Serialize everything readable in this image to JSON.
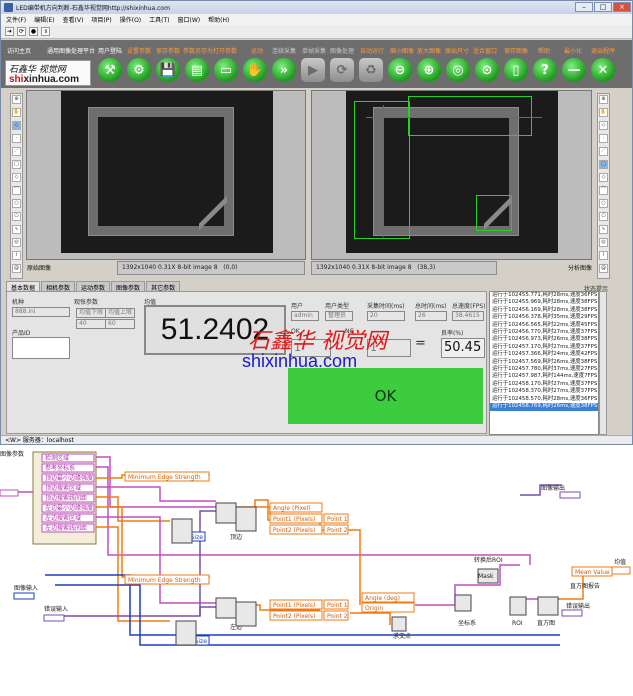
{
  "window": {
    "title": "LED编带机方向判断-石鑫华视觉网http://shixinhua.com"
  },
  "menu": [
    "文件(F)",
    "编辑(E)",
    "查看(V)",
    "项目(P)",
    "操作(O)",
    "工具(T)",
    "窗口(W)",
    "帮助(H)"
  ],
  "logo": {
    "line1": "石鑫华 视觉网",
    "line2_red": "shi",
    "line2_rest": "xinhua.com"
  },
  "nav": [
    "访问主页",
    "通用图像处理平台",
    "用户登陆",
    "设置参数",
    "保存参数",
    "参数另存为",
    "打开参数",
    "运动",
    "连续采集",
    "单帧采集",
    "图像处理",
    "自动运行",
    "缩小图像",
    "放大图像",
    "原始尺寸",
    "适合窗口",
    "保存图像",
    "帮助",
    "最小化",
    "退出程序"
  ],
  "toolbar_icons": [
    "home-icon",
    "user-icon",
    "tools-icon",
    "save-icon",
    "save-as-icon",
    "open-icon",
    "hand-icon",
    "fast-forward-icon",
    "play-icon",
    "process-icon",
    "recycle-icon",
    "zoom-out-icon",
    "zoom-in-icon",
    "zoom-actual-icon",
    "zoom-fit-icon",
    "save-image-icon",
    "help-icon",
    "minimize-icon",
    "close-icon"
  ],
  "left_image": {
    "label": "原始图像",
    "status": "1392x1040 0.31X 8-bit image 8",
    "coords": "(0,0)"
  },
  "right_image": {
    "label": "分析图像",
    "status": "1392x1040 0.31X 8-bit image 8",
    "coords": "(38,3)"
  },
  "tabs": [
    "基本数据",
    "相机参数",
    "运动参数",
    "图像参数",
    "其它参数"
  ],
  "params": {
    "model_label": "机种",
    "model_value": "888.ini",
    "product_label": "产品ID",
    "view_label": "观怅参数",
    "lower_label": "均值下限",
    "lower_value": "40",
    "upper_label": "均值上限",
    "upper_value": "60",
    "mean_label": "均值",
    "mean_value": "51.2402",
    "user_label": "用户",
    "user_value": "admin",
    "usertype_label": "用户类型",
    "usertype_value": "管理员",
    "acq_label": "采集时间(ms)",
    "acq_value": "20",
    "total_label": "总时间(ms)",
    "total_value": "26",
    "fps_label": "总速度(FPS)",
    "fps_value": "38.4615",
    "ok_label": "OK",
    "ng_label": "NG",
    "ok_count": "1",
    "ng_count": "1",
    "rate_label": "良率(%)",
    "rate_value": "50.45"
  },
  "status_label": "状态提示",
  "log": [
    "运行于102455.771,耗时28ms,速度36FPS",
    "运行于102455.969,耗时28ms,速度38FPS",
    "运行于102456.169,耗时28ms,速度38FPS",
    "运行于102456.378,耗时35ms,速度29FPS",
    "运行于102456.565,耗时22ms,速度45FPS",
    "运行于102456.770,耗时27ms,速度37FPS",
    "运行于102456.973,耗时26ms,速度38FPS",
    "运行于102457.170,耗时27ms,速度37FPS",
    "运行于102457.366,耗时24ms,速度42FPS",
    "运行于102457.569,耗时26ms,速度38FPS",
    "运行于102457.780,耗时37ms,速度27FPS",
    "运行于102457.987,耗时144ms,速度7FPS",
    "运行于102458.170,耗时27ms,速度37FPS",
    "运行于102458.370,耗时27ms,速度37FPS",
    "运行于102458.570,耗时28ms,速度36FPS",
    "运行于102458.769,耗时26ms,速度38FPS"
  ],
  "watermark": {
    "top": "石鑫华 视觉网",
    "bottom": "shixinhua.com"
  },
  "server": "<W> 服务器：localhost",
  "diagram": {
    "image_params": "图像参数",
    "image_input": "图像输入",
    "error_input": "错误输入",
    "cluster_items": [
      "检测区域",
      "参考坐标系",
      "顶边最小边缘强度",
      "顶边搜索区域",
      "顶边搜索线间距",
      "左边最小边缘强度",
      "左边搜索区域",
      "左边搜索线间距"
    ],
    "min_edge": "Minimum Edge Strength",
    "step_size": "Step Size",
    "angle_pixel": "Angle (Pixel)",
    "point1_pixels": "Point1 (Pixels)",
    "point2_pixels": "Point2 (Pixels)",
    "point1": "Point 1",
    "point2": "Point 2",
    "top_edge": "顶边",
    "left_edge": "左边",
    "angle_deg": "Angle (deg)",
    "origin": "Origin",
    "intersection": "求交点",
    "coord_sys": "坐标系",
    "convert_roi": "转换后ROI",
    "mask": "Mask",
    "roi": "ROI",
    "histogram": "直方图",
    "image_output": "图像输出",
    "mean_out": "均值",
    "mean_value": "Mean Value",
    "hist_report": "直方图报告",
    "error_output": "错误输出"
  }
}
